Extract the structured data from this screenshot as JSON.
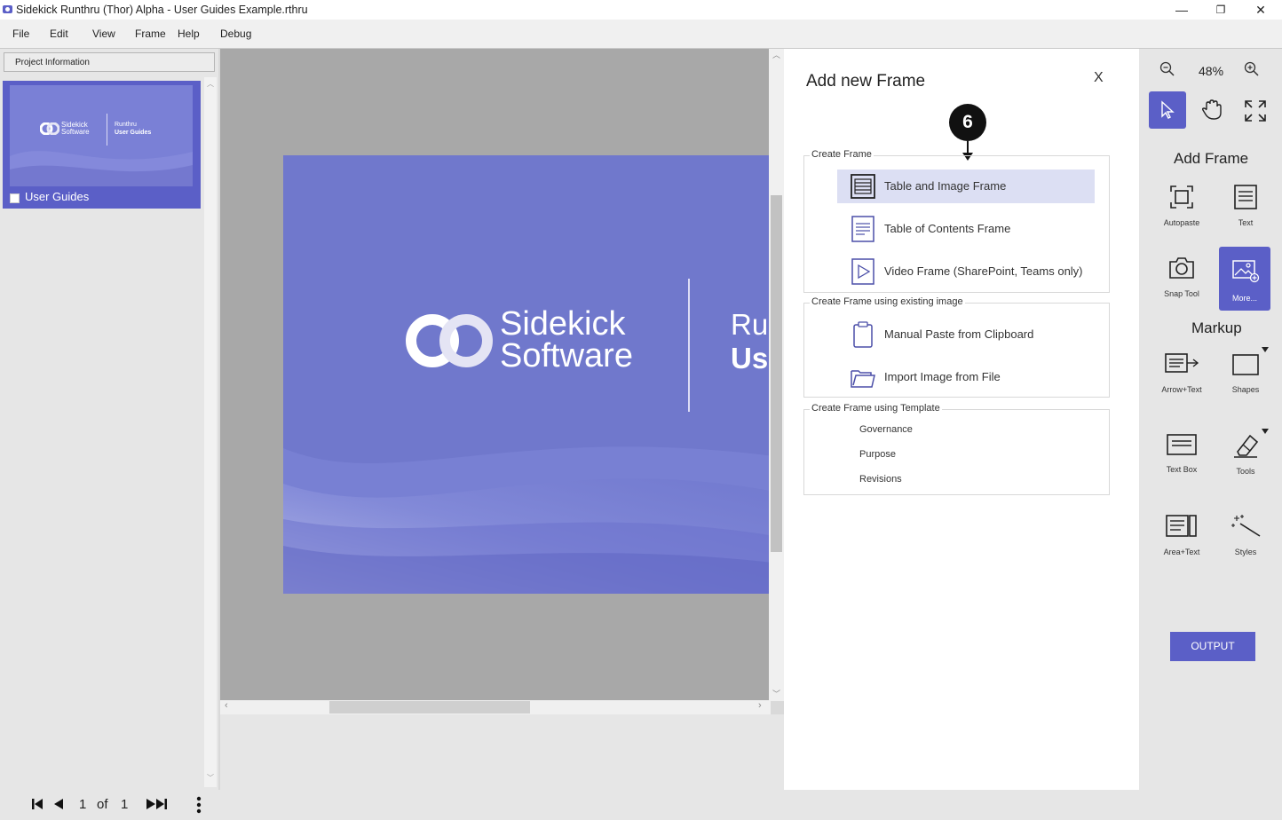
{
  "window": {
    "title": "Sidekick Runthru (Thor) Alpha - User Guides Example.rthru",
    "minimize": "—",
    "restore": "❐",
    "close": "✕"
  },
  "menu": [
    "File",
    "Edit",
    "View",
    "Frame",
    "Help",
    "Debug"
  ],
  "left_panel": {
    "project_info": "Project Information",
    "thumbnail": {
      "caption": "User Guides",
      "logo_line1": "Sidekick",
      "logo_line2": "Software",
      "right_line1": "Runthru",
      "right_line2": "User Guides"
    }
  },
  "slide": {
    "logo_line1": "Sidekick",
    "logo_line2": "Software",
    "right_line1": "Ru",
    "right_line2": "Us"
  },
  "dialog": {
    "title": "Add new Frame",
    "close": "X",
    "callout": "6",
    "create_frame": {
      "label": "Create Frame",
      "options": [
        {
          "label": "Table and Image Frame",
          "icon": "table-image-icon",
          "selected": true
        },
        {
          "label": "Table of Contents Frame",
          "icon": "document-lines-icon",
          "selected": false
        },
        {
          "label": "Video Frame (SharePoint, Teams only)",
          "icon": "video-play-icon",
          "selected": false
        }
      ]
    },
    "existing_image": {
      "label": "Create Frame using existing image",
      "options": [
        {
          "label": "Manual Paste from Clipboard",
          "icon": "clipboard-icon"
        },
        {
          "label": "Import Image from File",
          "icon": "folder-open-icon"
        }
      ]
    },
    "template": {
      "label": "Create Frame using Template",
      "items": [
        "Governance",
        "Purpose",
        "Revisions"
      ]
    }
  },
  "right_toolbar": {
    "zoom": "48%",
    "add_frame_title": "Add Frame",
    "add_frame_tools": [
      {
        "label": "Autopaste",
        "icon": "autopaste-icon"
      },
      {
        "label": "Text",
        "icon": "text-lines-icon"
      },
      {
        "label": "Snap Tool",
        "icon": "camera-icon"
      },
      {
        "label": "More...",
        "icon": "image-add-icon"
      }
    ],
    "markup_title": "Markup",
    "markup_tools": [
      {
        "label": "Arrow+Text",
        "icon": "arrow-text-icon"
      },
      {
        "label": "Shapes",
        "icon": "rectangle-icon"
      },
      {
        "label": "Text Box",
        "icon": "text-box-icon"
      },
      {
        "label": "Tools",
        "icon": "eraser-icon"
      },
      {
        "label": "Area+Text",
        "icon": "area-text-icon"
      },
      {
        "label": "Styles",
        "icon": "magic-wand-icon"
      }
    ],
    "output": "OUTPUT"
  },
  "pager": {
    "current": "1",
    "of": "of",
    "total": "1"
  },
  "colors": {
    "accent": "#5b5fc7",
    "slide_bg": "#7078cc",
    "selected_row": "#dcdff3"
  }
}
